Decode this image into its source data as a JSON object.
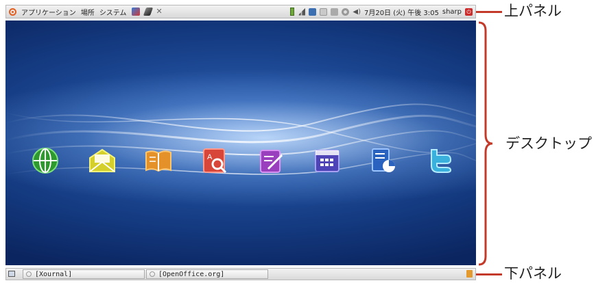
{
  "top_panel": {
    "menus": [
      "アプリケーション",
      "場所",
      "システム"
    ],
    "launchers": [
      "network-icon",
      "pen-icon",
      "tools-icon"
    ],
    "tray_icons": [
      "battery-icon",
      "signal-icon",
      "network-manager-icon",
      "input-method-icon",
      "printer-icon",
      "brightness-icon",
      "volume-icon"
    ],
    "clock": "7月20日 (火) 午後 3:05",
    "user": "sharp"
  },
  "desktop": {
    "apps": [
      {
        "icon": "globe-icon",
        "color": "#3ec43e"
      },
      {
        "icon": "mail-icon",
        "color": "#e6e23a"
      },
      {
        "icon": "book-icon",
        "color": "#f0a030"
      },
      {
        "icon": "dictionary-icon",
        "color": "#e2574a"
      },
      {
        "icon": "notepad-icon",
        "color": "#a64cc4"
      },
      {
        "icon": "calendar-icon",
        "color": "#5a4ec8"
      },
      {
        "icon": "document-icon",
        "color": "#2f6fcf"
      },
      {
        "icon": "twitter-icon",
        "color": "#4fc4e8"
      }
    ]
  },
  "bottom_panel": {
    "tasks": [
      "[Xournal]",
      "[OpenOffice.org]"
    ]
  },
  "annotations": {
    "top_label": "上パネル",
    "desktop_label": "デスクトップ",
    "bottom_label": "下パネル",
    "accent_color": "#c33a2a"
  }
}
